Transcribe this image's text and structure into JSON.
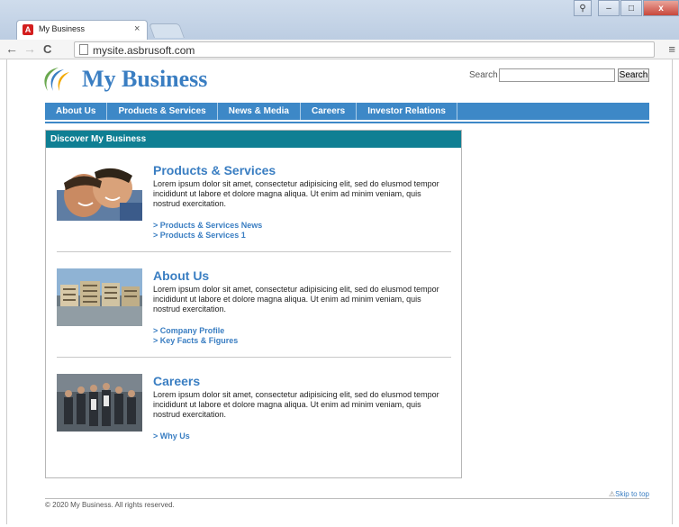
{
  "browser": {
    "tab_title": "My Business",
    "tab_close": "×",
    "url": "mysite.asbrusoft.com",
    "back_glyph": "←",
    "forward_glyph": "→",
    "reload_glyph": "C",
    "menu_glyph": "≡",
    "win_minimize": "–",
    "win_maximize": "□",
    "win_close": "x",
    "win_user": "⚲",
    "icons": [
      "back-icon",
      "forward-icon",
      "reload-icon",
      "page-icon",
      "menu-icon",
      "favicon"
    ]
  },
  "site": {
    "brand": "My Business",
    "search_label": "Search",
    "search_value": "",
    "search_button": "Search"
  },
  "nav": {
    "items": [
      "About Us",
      "Products & Services",
      "News & Media",
      "Careers",
      "Investor Relations"
    ]
  },
  "panel": {
    "header": "Discover My Business",
    "items": [
      {
        "title": "Products & Services",
        "desc": "Lorem ipsum dolor sit amet, consectetur adipisicing elit, sed do elusmod tempor incididunt ut labore et dolore magna aliqua. Ut enim ad minim veniam, quis nostrud exercitation.",
        "links": [
          "> Products & Services News",
          "> Products & Services 1"
        ]
      },
      {
        "title": "About Us",
        "desc": "Lorem ipsum dolor sit amet, consectetur adipisicing elit, sed do elusmod tempor incididunt ut labore et dolore magna aliqua. Ut enim ad minim veniam, quis nostrud exercitation.",
        "links": [
          "> Company Profile",
          "> Key Facts & Figures"
        ]
      },
      {
        "title": "Careers",
        "desc": "Lorem ipsum dolor sit amet, consectetur adipisicing elit, sed do elusmod tempor incididunt ut labore et dolore magna aliqua. Ut enim ad minim veniam, quis nostrud exercitation.",
        "links": [
          "> Why Us"
        ]
      }
    ]
  },
  "footer": {
    "copyright": "© 2020 My Business. All rights reserved.",
    "skip": "Skip to top"
  },
  "colors": {
    "brand_blue": "#3a7ec2",
    "nav_blue": "#3d88c7",
    "panel_header_teal": "#0f7f93"
  }
}
